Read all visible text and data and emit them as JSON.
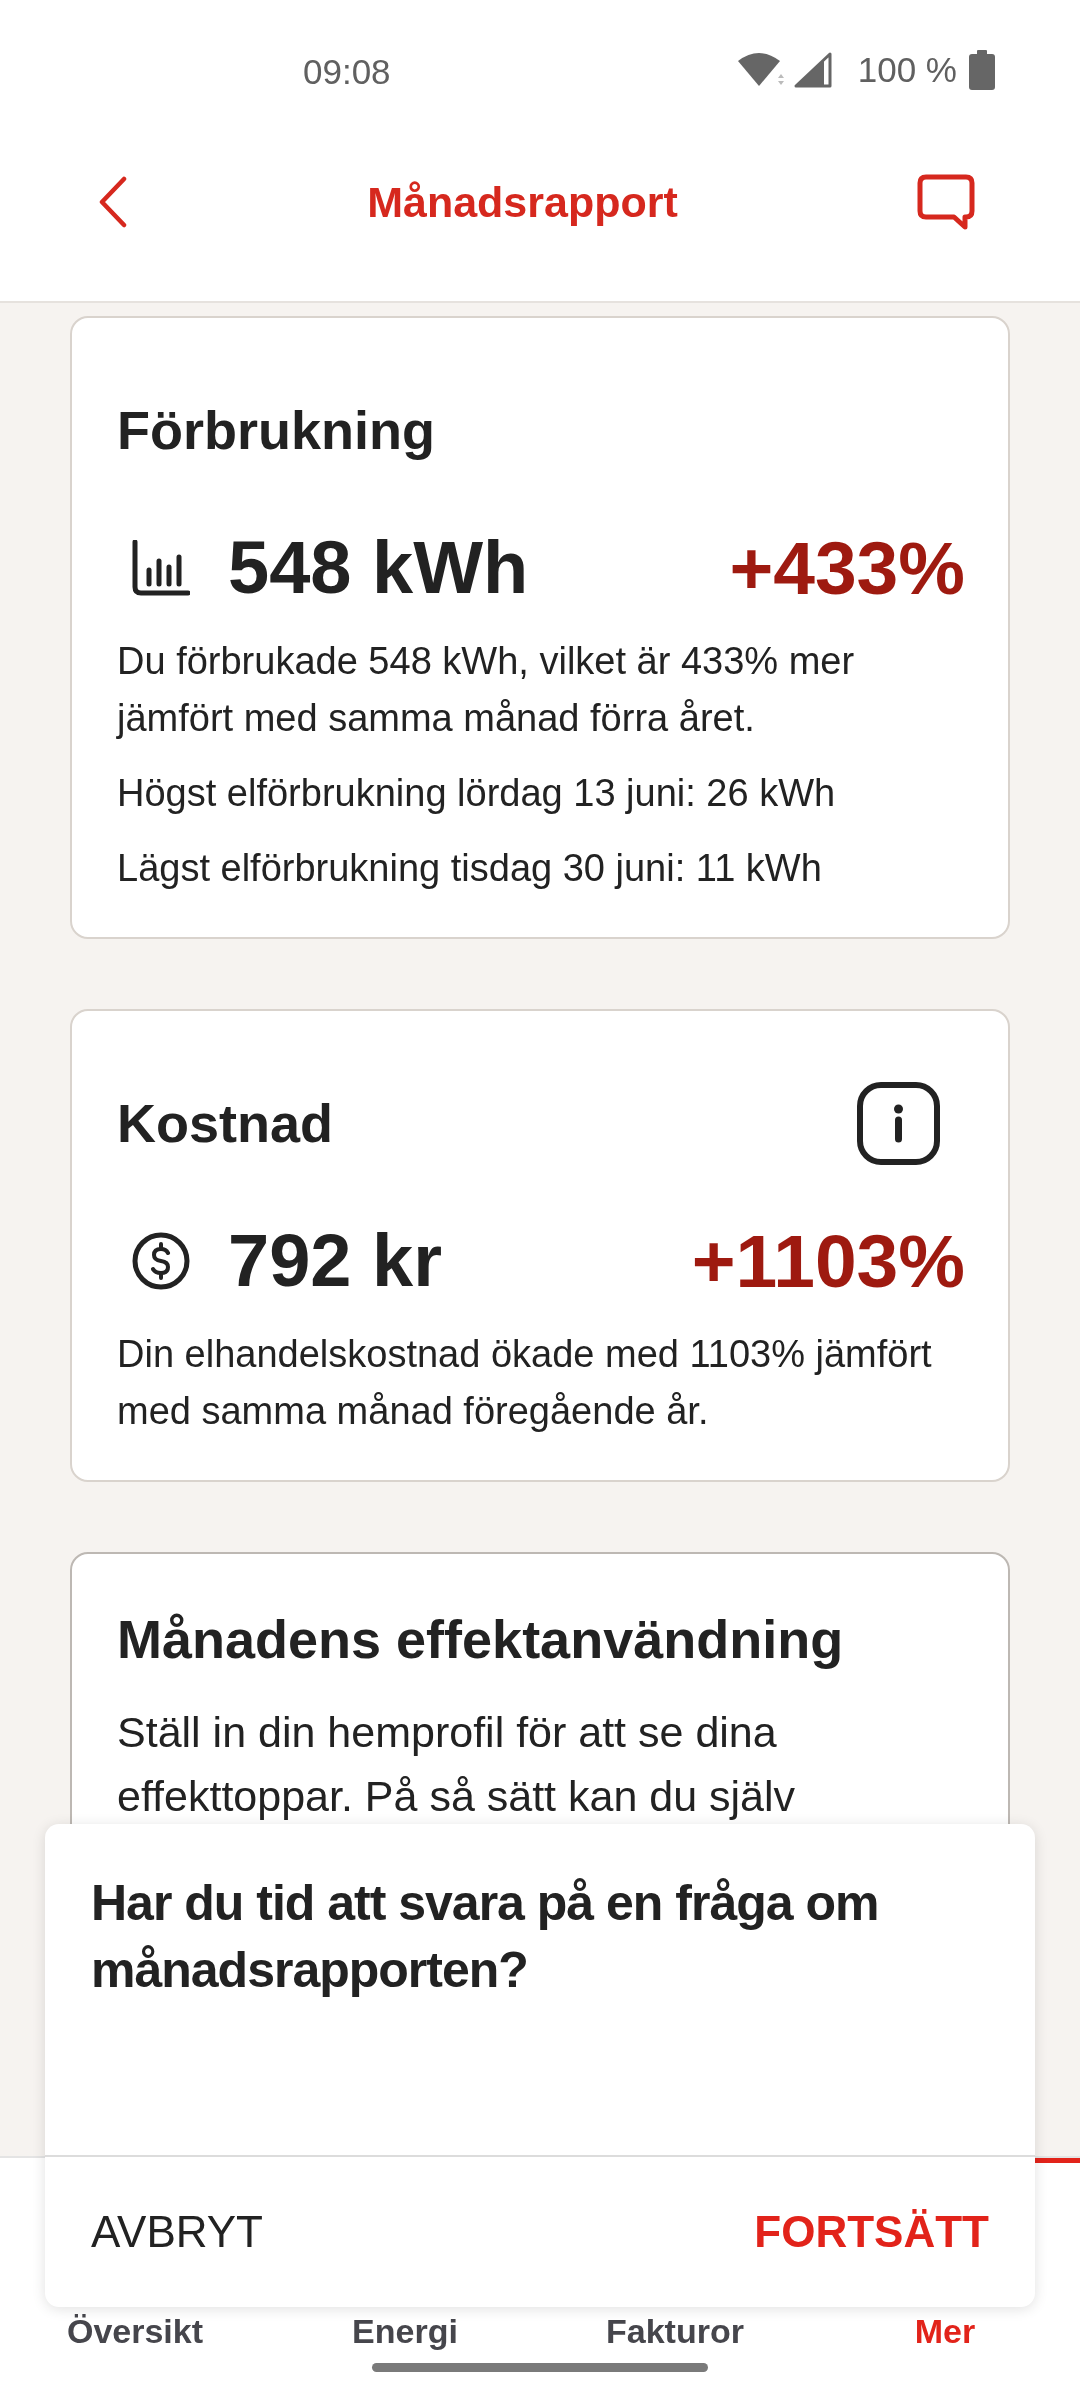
{
  "status_bar": {
    "time": "09:08",
    "battery": "100 %"
  },
  "header": {
    "title": "Månadsrapport"
  },
  "cards": [
    {
      "kind": "energy",
      "title": "Förbrukning",
      "info_button": false,
      "value": "548 kWh",
      "change": "+433%",
      "paragraphs": [
        "Du förbrukade 548 kWh, vilket är 433% mer jämfört med samma månad förra året.",
        "Högst elförbrukning lördag 13 juni: 26 kWh",
        "Lägst elförbrukning tisdag 30 juni: 11 kWh"
      ]
    },
    {
      "kind": "cost",
      "title": "Kostnad",
      "info_button": true,
      "value": "792 kr",
      "change": "+1103%",
      "paragraphs": [
        "Din elhandelskostnad ökade med 1103% jämfört med samma månad föregående år."
      ]
    },
    {
      "kind": "text",
      "title": "Månadens effektanvändning",
      "info_button": false,
      "paragraphs": [
        "Ställ in din hemprofil för att se dina effekttoppar. På så sätt kan du själv"
      ]
    }
  ],
  "dialog": {
    "title": "Har du tid att svara på en fråga om månadsrapporten?",
    "buttons": [
      {
        "label": "AVBRYT",
        "kind": "cancel"
      },
      {
        "label": "FORTSÄTT",
        "kind": "confirm"
      }
    ]
  },
  "nav": {
    "tabs": [
      {
        "label": "Översikt",
        "selected": false
      },
      {
        "label": "Energi",
        "selected": false
      },
      {
        "label": "Fakturor",
        "selected": false
      },
      {
        "label": "Mer",
        "selected": true
      }
    ]
  }
}
